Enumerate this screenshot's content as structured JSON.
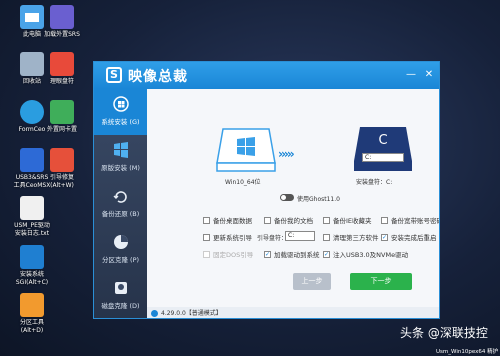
{
  "desktop_icons": [
    {
      "label": "此电脑"
    },
    {
      "label": "加载外置SRS"
    },
    {
      "label": "回收站"
    },
    {
      "label": "理眼盘符"
    },
    {
      "label": "FormCeo"
    },
    {
      "label": "外置网卡置"
    },
    {
      "label": "USB3&SRS\n工具CeoMSX"
    },
    {
      "label": "引导修复\n(Alt+W)"
    },
    {
      "label": "USM_PE驱动\n安装日志.txt"
    },
    {
      "label": "安装系统\nSGI(Alt+C)"
    },
    {
      "label": "分区工具\n(Alt+D)"
    }
  ],
  "window": {
    "title": "映像总裁",
    "sidebar": [
      {
        "label": "系统安装 (G)"
      },
      {
        "label": "原版安装 (M)"
      },
      {
        "label": "备份还原 (B)"
      },
      {
        "label": "分区克隆 (P)"
      },
      {
        "label": "磁盘克隆 (D)"
      }
    ],
    "source_label": "Win10_64位",
    "target_letter": "C",
    "target_select": "C:",
    "target_label": "安装盘符：C:",
    "ghost_toggle_label": "使用Ghost11.0",
    "options": {
      "backup_desktop": "备份桌面数据",
      "backup_docs": "备份我的文档",
      "backup_favorites": "备份IE收藏夹",
      "backup_wifi": "备份宽带账号密码",
      "update_boot": "更新系统引导",
      "boot_drive_label": "引导盘符：",
      "boot_drive_value": "C:",
      "clean_thirdparty": "清理第三方软件",
      "restart_after": "安装完成后重启",
      "dim_option": "固定DOS引导",
      "load_drivers": "加载驱动到系统",
      "inject_usb": "注入USB3.0及NVMe驱动"
    },
    "btn_prev": "上一步",
    "btn_next": "下一步",
    "version": "4.29.0.0【普通模式】"
  },
  "watermark": "头条 @深联技控",
  "watermark_sub": "Usm_Win10pex64 精护版",
  "colors": {
    "accent": "#1a86d6",
    "next": "#2bb24c"
  }
}
